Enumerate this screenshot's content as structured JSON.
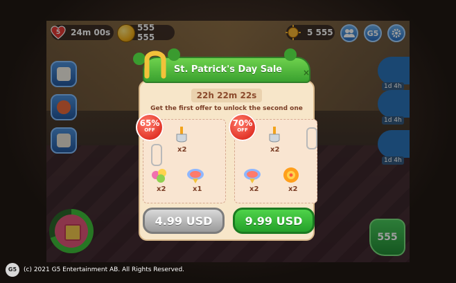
{
  "hud": {
    "lives_count": "5",
    "lives_timer": "24m 00s",
    "coins": "555 555",
    "stars": "5 555",
    "g5_label": "G5"
  },
  "side_timers": [
    "1d 4h",
    "1d 4h",
    "1d 4h"
  ],
  "play_button_label": "555",
  "dialog": {
    "title": "St. Patrick's Day Sale",
    "close_label": "×",
    "countdown": "22h 22m 22s",
    "subtitle": "Get the first offer to unlock the second one",
    "offers": [
      {
        "discount": "65%",
        "off_label": "OFF",
        "items": [
          {
            "icon": "shovel-icon",
            "qty": "x2"
          },
          {
            "icon": "candy-icon",
            "qty": "x2"
          },
          {
            "icon": "spinning-top-icon",
            "qty": "x1"
          }
        ],
        "price": "4.99 USD"
      },
      {
        "discount": "70%",
        "off_label": "OFF",
        "items": [
          {
            "icon": "shovel-icon",
            "qty": "x2"
          },
          {
            "icon": "spinning-top-icon",
            "qty": "x2"
          },
          {
            "icon": "lollipop-icon",
            "qty": "x2"
          }
        ],
        "price": "9.99 USD"
      }
    ]
  },
  "footer": {
    "logo_text": "G5",
    "copyright": "(c) 2021 G5 Entertainment AB. All Rights Reserved."
  },
  "colors": {
    "dialog_green": "#3aa12f",
    "buy_green": "#24a02a",
    "locked_grey": "#9a9a9a",
    "badge_red": "#e03024",
    "paper": "#f7e6c9"
  }
}
